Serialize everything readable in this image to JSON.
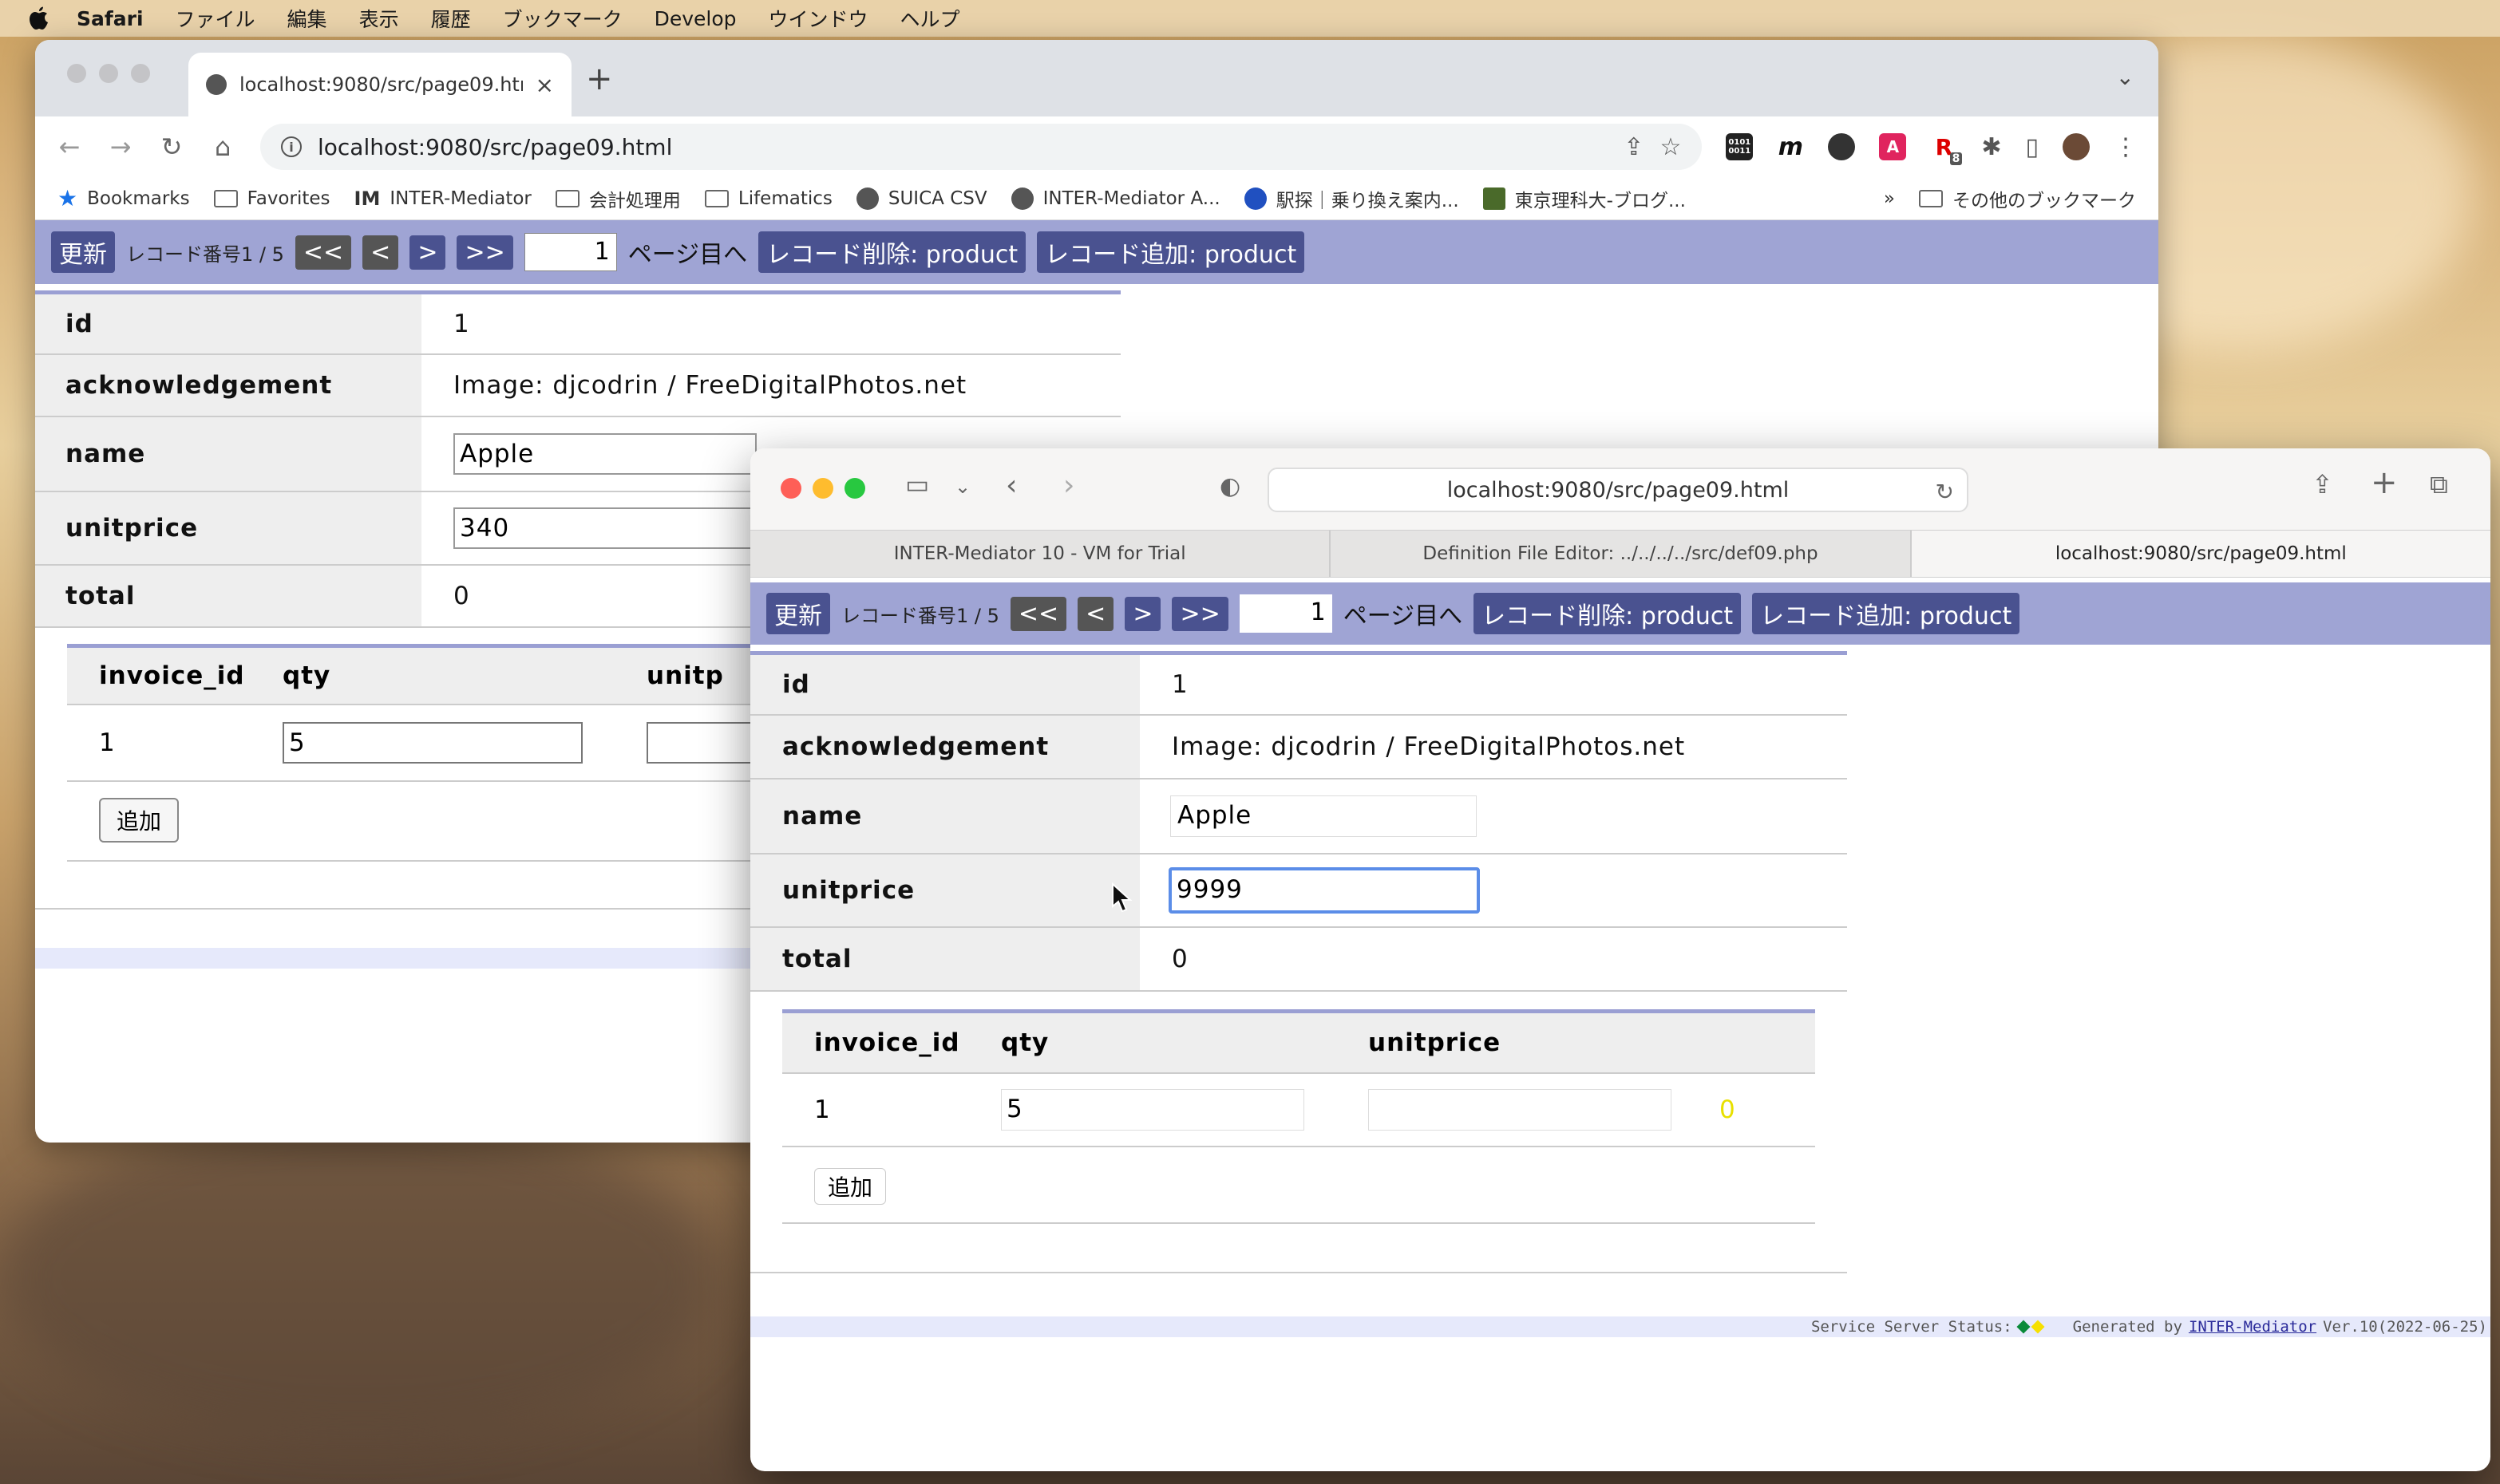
{
  "menubar": {
    "items": [
      "Safari",
      "ファイル",
      "編集",
      "表示",
      "履歴",
      "ブックマーク",
      "Develop",
      "ウインドウ",
      "ヘルプ"
    ]
  },
  "chrome": {
    "tab_title": "localhost:9080/src/page09.html",
    "tab_close": "×",
    "new_tab": "+",
    "url": "localhost:9080/src/page09.html",
    "bookmarks": [
      "Bookmarks",
      "Favorites",
      "INTER-Mediator",
      "会計処理用",
      "Lifematics",
      "SUICA CSV",
      "INTER-Mediator A...",
      "駅探｜乗り換え案内...",
      "東京理科大-ブログ..."
    ],
    "bookmarks_more": "»",
    "other_bookmarks": "その他のブックマーク",
    "ext_labels": {
      "binary": "0101\n0011",
      "m": "m",
      "acrobat": "A",
      "r": "R",
      "badge": "8"
    }
  },
  "safari": {
    "url": "localhost:9080/src/page09.html",
    "tabs": [
      "INTER-Mediator 10 - VM for Trial",
      "Definition File Editor: ../../../../src/def09.php",
      "localhost:9080/src/page09.html"
    ]
  },
  "im": {
    "update_btn": "更新",
    "record_counter": "レコード番号1 / 5",
    "first_btn": "<<",
    "prev_btn": "<",
    "next_btn": ">",
    "last_btn": ">>",
    "page_value": "1",
    "page_label": "ページ目へ",
    "delete_btn": "レコード削除: product",
    "add_btn": "レコード追加: product",
    "labels": {
      "id": "id",
      "ack": "acknowledgement",
      "name": "name",
      "unitprice": "unitprice",
      "total": "total"
    },
    "sub_headers": {
      "invoice_id": "invoice_id",
      "qty": "qty",
      "unitprice": "unitprice"
    },
    "sub_add": "追加"
  },
  "chrome_record": {
    "id": "1",
    "ack": "Image: djcodrin / FreeDigitalPhotos.net",
    "name": "Apple",
    "unitprice": "340",
    "total": "0",
    "sub_unitprice_header": "unitp",
    "row_invoice": "1",
    "row_qty": "5"
  },
  "safari_record": {
    "id": "1",
    "ack": "Image: djcodrin / FreeDigitalPhotos.net",
    "name": "Apple",
    "unitprice": "9999",
    "total": "0",
    "row_invoice": "1",
    "row_qty": "5",
    "row_unitprice": "",
    "row_amount": "0"
  },
  "footer": {
    "status_label": "Service Server Status:",
    "generated_by": "Generated by",
    "link": "INTER-Mediator",
    "version": "Ver.10(2022-06-25)"
  },
  "colors": {
    "nav_bg": "#9fa4d4",
    "button_bg": "#4a5290",
    "accent_line": "#9a9fd3",
    "focus_blue": "#5b8de8"
  }
}
